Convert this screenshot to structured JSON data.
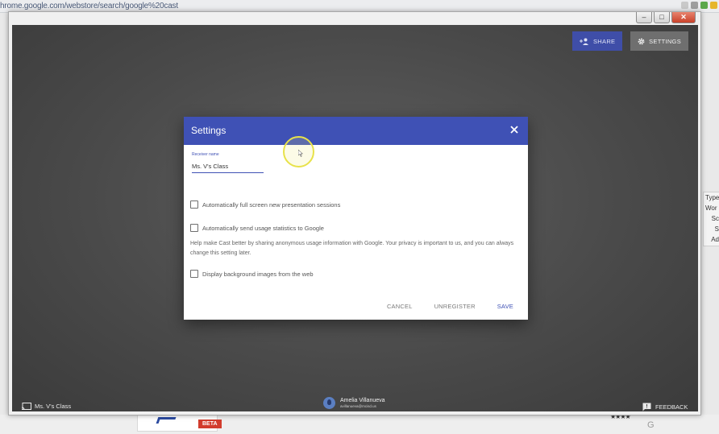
{
  "browser": {
    "url": "hrome.google.com/webstore/search/google%20cast"
  },
  "background_page": {
    "badge": "BETA",
    "side_panel_items": [
      "Type",
      "Wor",
      "Sc",
      "S",
      "Ad"
    ],
    "footer_letter": "G"
  },
  "app": {
    "share_label": "SHARE",
    "settings_label": "SETTINGS",
    "receiver_name_footer": "Ms. V's Class",
    "user": {
      "name": "Amelia Villanueva",
      "email": "avillanueva@mcisd.us"
    },
    "feedback_label": "FEEDBACK"
  },
  "dialog": {
    "title": "Settings",
    "receiver_label": "Receiver name",
    "receiver_value": "Ms. V's Class",
    "options": [
      {
        "label": "Automatically full screen new presentation sessions",
        "checked": false
      },
      {
        "label": "Automatically send usage statistics to Google",
        "checked": false
      },
      {
        "label": "Display background images from the web",
        "checked": false
      }
    ],
    "help_text": "Help make Cast better by sharing anonymous usage information with Google. Your privacy is important to us, and you can always change this setting later.",
    "actions": {
      "cancel": "CANCEL",
      "unregister": "UNREGISTER",
      "save": "SAVE"
    }
  },
  "colors": {
    "primary": "#3f51b5",
    "app_background": "#4a4a4a",
    "window_close": "#c8412a"
  }
}
